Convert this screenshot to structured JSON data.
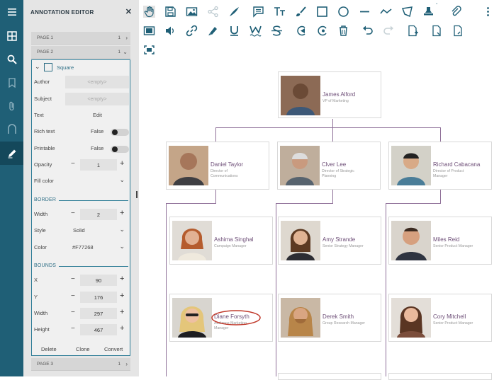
{
  "panel": {
    "title": "ANNOTATION EDITOR",
    "close_icon": "close-icon",
    "pages": [
      {
        "label": "PAGE 1",
        "count": "1",
        "chevron": "›"
      },
      {
        "label": "PAGE 2",
        "count": "1",
        "chevron": "⌄"
      },
      {
        "label": "PAGE 3",
        "count": "1",
        "chevron": "›"
      }
    ]
  },
  "annotation": {
    "type": "Square",
    "author_label": "Author",
    "author_placeholder": "<empty>",
    "subject_label": "Subject",
    "subject_placeholder": "<empty>",
    "text_label": "Text",
    "text_action": "Edit",
    "rich_text_label": "Rich text",
    "rich_text_value": "False",
    "printable_label": "Printable",
    "printable_value": "False",
    "opacity_label": "Opacity",
    "opacity_value": "1",
    "fill_label": "Fill color",
    "border_section": "BORDER",
    "border_width_label": "Width",
    "border_width_value": "2",
    "style_label": "Style",
    "style_value": "Solid",
    "color_label": "Color",
    "color_value": "#F77268",
    "bounds_section": "BOUNDS",
    "x_label": "X",
    "x_value": "90",
    "y_label": "Y",
    "y_value": "176",
    "width_label": "Width",
    "width_value": "297",
    "height_label": "Height",
    "height_value": "467",
    "delete_label": "Delete",
    "clone_label": "Clone",
    "convert_label": "Convert",
    "minus": "−",
    "plus": "+",
    "chevron": "⌄"
  },
  "colors": {
    "rail": "#1f5f76",
    "accent": "#2e7d97",
    "connector": "#8e6f98",
    "name": "#6e4f78",
    "highlight_ellipse": "#c0392b"
  },
  "org": [
    {
      "name": "James Alford",
      "role": "VP of Marketing"
    },
    {
      "name": "Daniel Taylor",
      "role": "Director of Communications"
    },
    {
      "name": "Clver Lee",
      "role": "Director of Strategic Planning"
    },
    {
      "name": "Richard Cabacana",
      "role": "Director of Product Manager"
    },
    {
      "name": "Ashima Singhal",
      "role": "Campaign Manager"
    },
    {
      "name": "Amy Strande",
      "role": "Senior Strategy Manager"
    },
    {
      "name": "Miles Reid",
      "role": "Senior Product Manager"
    },
    {
      "name": "Diane Forsyth",
      "role": "Audience Marketing Manager"
    },
    {
      "name": "Derek Smith",
      "role": "Group Research Manager"
    },
    {
      "name": "Cory Mitchell",
      "role": "Senior Product Manager"
    }
  ]
}
